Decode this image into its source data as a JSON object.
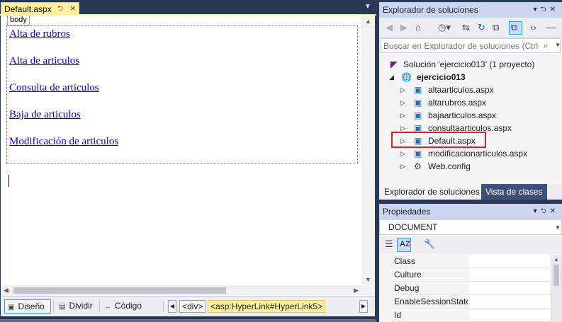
{
  "document": {
    "tab_title": "Default.aspx",
    "pin_icon": "pin-icon",
    "close_icon": "close-icon",
    "body_tag": "body",
    "links": [
      "Alta de rubros",
      "Alta de articulos",
      "Consulta de articulos",
      "Baja de articulos",
      "Modificación de articulos"
    ],
    "link_color": "#0000ee",
    "tab_color": "#fff29d"
  },
  "view_bar": {
    "design": "Diseño",
    "split": "Dividir",
    "code": "Código",
    "active_view": "Diseño",
    "breadcrumbs": [
      "<div>",
      "<asp:HyperLink#HyperLink5>"
    ]
  },
  "solution_explorer": {
    "title": "Explorador de soluciones",
    "search_placeholder": "Buscar en Explorador de soluciones (Ctrl+",
    "solution_label": "Solución 'ejercicio013'  (1 proyecto)",
    "project": "ejercicio013",
    "files": [
      "altaarticulos.aspx",
      "altarubros.aspx",
      "bajaarticulos.aspx",
      "consultaarticulos.aspx",
      "Default.aspx",
      "modificacionarticulos.aspx",
      "Web.config"
    ],
    "selected_file": "Default.aspx",
    "highlight_color": "#e02020",
    "tabs": [
      "Explorador de soluciones",
      "Vista de clases"
    ]
  },
  "properties": {
    "title": "Propiedades",
    "object": "DOCUMENT",
    "rows": [
      "Class",
      "Culture",
      "Debug",
      "EnableSessionState",
      "Id"
    ]
  },
  "theme": {
    "chrome": "#293955",
    "panel_title": "#ccd5f0"
  }
}
